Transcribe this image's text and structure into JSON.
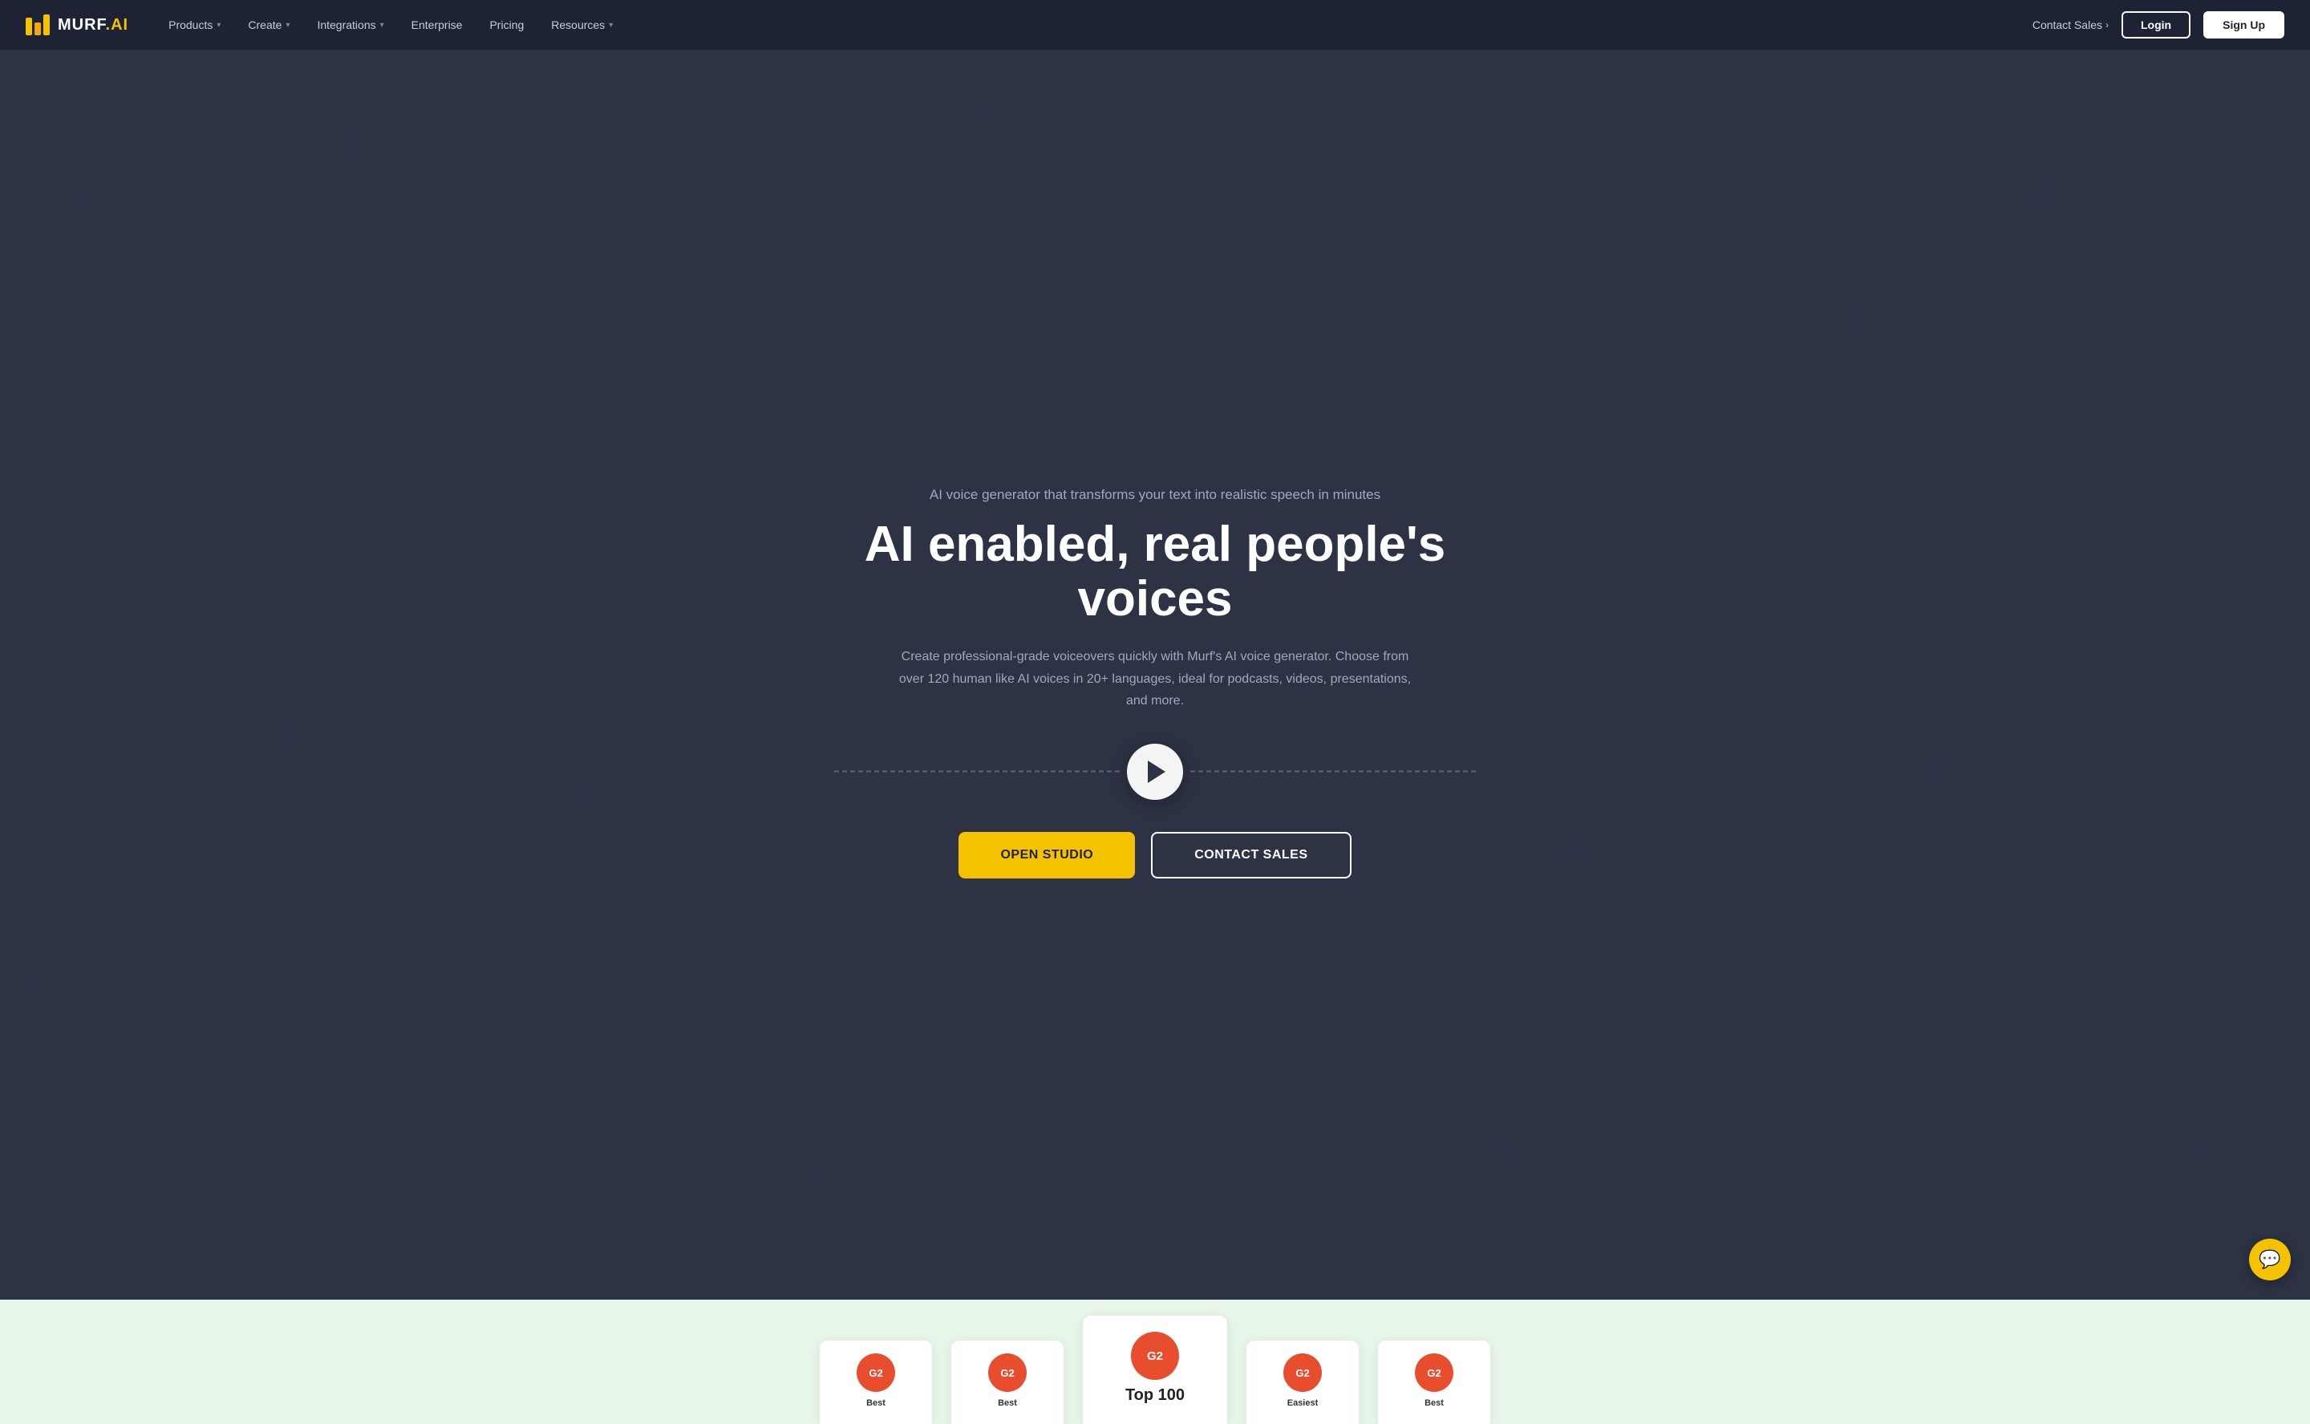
{
  "brand": {
    "name": "MURF.AI",
    "name_part1": "MURF",
    "name_part2": ".AI"
  },
  "navbar": {
    "contact_sales": "Contact Sales",
    "contact_sales_arrow": "›",
    "login": "Login",
    "signup": "Sign Up",
    "nav_items": [
      {
        "label": "Products",
        "has_dropdown": true
      },
      {
        "label": "Create",
        "has_dropdown": true
      },
      {
        "label": "Integrations",
        "has_dropdown": true
      },
      {
        "label": "Enterprise",
        "has_dropdown": false
      },
      {
        "label": "Pricing",
        "has_dropdown": false
      },
      {
        "label": "Resources",
        "has_dropdown": true
      }
    ]
  },
  "hero": {
    "subtitle": "AI voice generator that transforms your text into realistic speech in minutes",
    "title": "AI enabled, real people's voices",
    "description": "Create professional-grade voiceovers quickly with Murf's AI voice generator. Choose from over 120 human like AI voices in 20+ languages, ideal for podcasts, videos, presentations, and more.",
    "btn_open_studio": "OPEN STUDIO",
    "btn_contact_sales": "CONTACT SALES"
  },
  "awards": [
    {
      "badge": "G2",
      "label": "Best",
      "featured": false
    },
    {
      "badge": "G2",
      "label": "Best",
      "featured": false
    },
    {
      "badge": "G2",
      "label": "Top 100",
      "featured": true
    },
    {
      "badge": "G2",
      "label": "Easiest",
      "featured": false
    },
    {
      "badge": "G2",
      "label": "Best",
      "featured": false
    }
  ],
  "chat": {
    "icon": "💬"
  }
}
